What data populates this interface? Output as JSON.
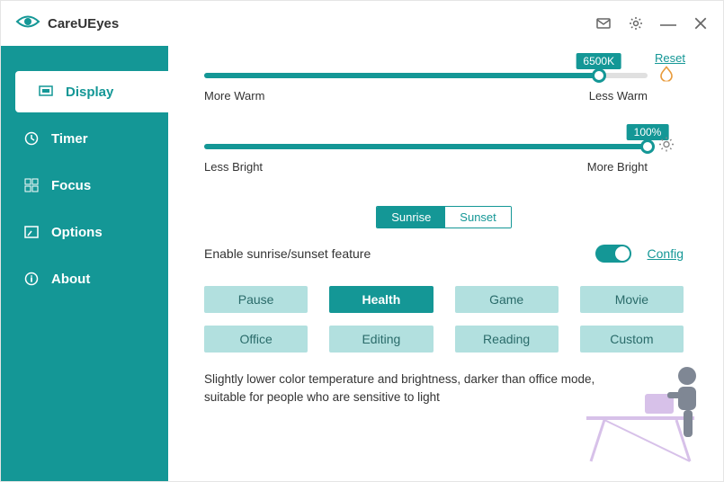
{
  "app": {
    "title": "CareUEyes"
  },
  "sidebar": {
    "items": [
      {
        "label": "Display"
      },
      {
        "label": "Timer"
      },
      {
        "label": "Focus"
      },
      {
        "label": "Options"
      },
      {
        "label": "About"
      }
    ]
  },
  "sliders": {
    "temp": {
      "badge": "6500K",
      "percent": 89,
      "left_label": "More Warm",
      "right_label": "Less Warm",
      "reset": "Reset"
    },
    "bright": {
      "badge": "100%",
      "percent": 100,
      "left_label": "Less Bright",
      "right_label": "More Bright"
    }
  },
  "segmented": {
    "sunrise": "Sunrise",
    "sunset": "Sunset"
  },
  "enable": {
    "label": "Enable sunrise/sunset feature",
    "on": true,
    "config": "Config"
  },
  "modes": [
    "Pause",
    "Health",
    "Game",
    "Movie",
    "Office",
    "Editing",
    "Reading",
    "Custom"
  ],
  "active_mode_index": 1,
  "description": "Slightly lower color temperature and brightness, darker than office mode, suitable for people who are sensitive to light",
  "colors": {
    "accent": "#149796"
  }
}
